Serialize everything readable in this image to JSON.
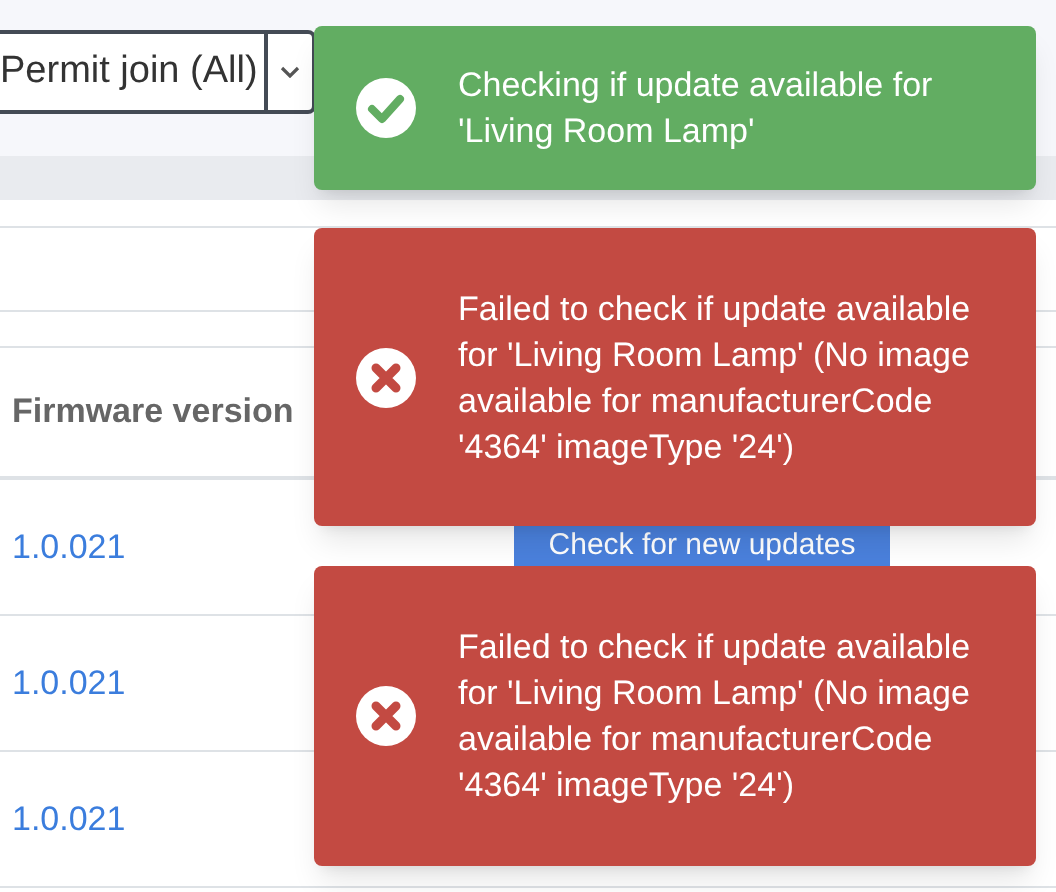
{
  "toolbar": {
    "permit_join": "Permit join (All)"
  },
  "table": {
    "columns": [
      "Firmware version"
    ],
    "rows": [
      {
        "firmware": "1.0.021",
        "action": "Check for new updates"
      },
      {
        "firmware": "1.0.021"
      },
      {
        "firmware": "1.0.021"
      }
    ]
  },
  "toasts": [
    {
      "kind": "success",
      "message": "Checking if update available for 'Living Room Lamp'"
    },
    {
      "kind": "error",
      "message": "Failed to check if update available for 'Living Room Lamp' (No image available for manufacturerCode '4364' imageType '24')"
    },
    {
      "kind": "error",
      "message": "Failed to check if update available for 'Living Room Lamp' (No image available for manufacturerCode '4364' imageType '24')"
    }
  ]
}
